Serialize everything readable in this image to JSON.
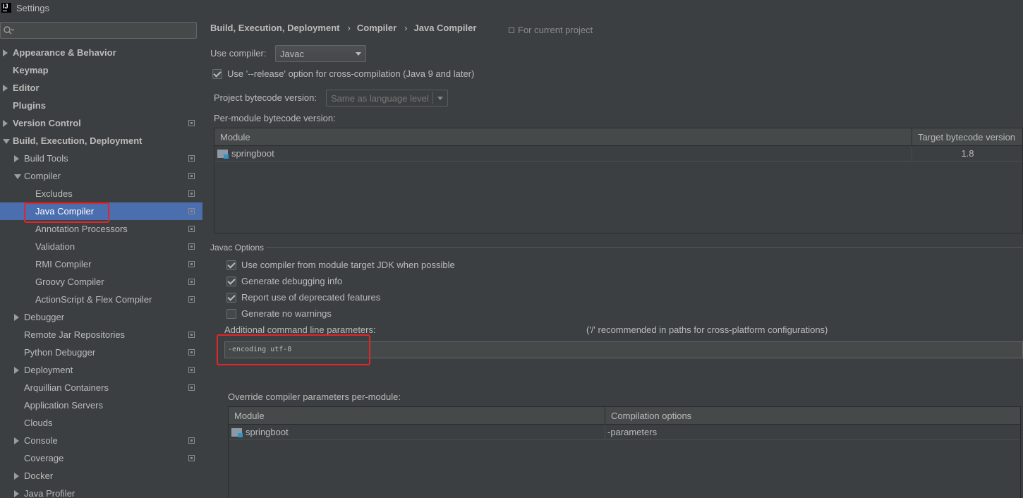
{
  "window": {
    "title": "Settings",
    "icon": "intellij-app-icon"
  },
  "sidebar": {
    "search": {
      "value": "",
      "placeholder": ""
    },
    "items": [
      {
        "label": "Appearance & Behavior",
        "bold": true,
        "expander": "right",
        "level": 0,
        "project_icon": false
      },
      {
        "label": "Keymap",
        "bold": true,
        "expander": "none",
        "level": 0,
        "project_icon": false
      },
      {
        "label": "Editor",
        "bold": true,
        "expander": "right",
        "level": 0,
        "project_icon": false
      },
      {
        "label": "Plugins",
        "bold": true,
        "expander": "none",
        "level": 0,
        "project_icon": false
      },
      {
        "label": "Version Control",
        "bold": true,
        "expander": "right",
        "level": 0,
        "project_icon": true
      },
      {
        "label": "Build, Execution, Deployment",
        "bold": true,
        "expander": "down",
        "level": 0,
        "project_icon": false
      },
      {
        "label": "Build Tools",
        "bold": false,
        "expander": "right",
        "level": 1,
        "project_icon": true
      },
      {
        "label": "Compiler",
        "bold": false,
        "expander": "down",
        "level": 1,
        "project_icon": true
      },
      {
        "label": "Excludes",
        "bold": false,
        "expander": "none",
        "level": 2,
        "project_icon": true
      },
      {
        "label": "Java Compiler",
        "bold": false,
        "expander": "none",
        "level": 2,
        "project_icon": true,
        "selected": true
      },
      {
        "label": "Annotation Processors",
        "bold": false,
        "expander": "none",
        "level": 2,
        "project_icon": true
      },
      {
        "label": "Validation",
        "bold": false,
        "expander": "none",
        "level": 2,
        "project_icon": true
      },
      {
        "label": "RMI Compiler",
        "bold": false,
        "expander": "none",
        "level": 2,
        "project_icon": true
      },
      {
        "label": "Groovy Compiler",
        "bold": false,
        "expander": "none",
        "level": 2,
        "project_icon": true
      },
      {
        "label": "ActionScript & Flex Compiler",
        "bold": false,
        "expander": "none",
        "level": 2,
        "project_icon": true
      },
      {
        "label": "Debugger",
        "bold": false,
        "expander": "right",
        "level": 1,
        "project_icon": false
      },
      {
        "label": "Remote Jar Repositories",
        "bold": false,
        "expander": "none",
        "level": 1,
        "project_icon": true
      },
      {
        "label": "Python Debugger",
        "bold": false,
        "expander": "none",
        "level": 1,
        "project_icon": true
      },
      {
        "label": "Deployment",
        "bold": false,
        "expander": "right",
        "level": 1,
        "project_icon": true
      },
      {
        "label": "Arquillian Containers",
        "bold": false,
        "expander": "none",
        "level": 1,
        "project_icon": true
      },
      {
        "label": "Application Servers",
        "bold": false,
        "expander": "none",
        "level": 1,
        "project_icon": false
      },
      {
        "label": "Clouds",
        "bold": false,
        "expander": "none",
        "level": 1,
        "project_icon": false
      },
      {
        "label": "Console",
        "bold": false,
        "expander": "right",
        "level": 1,
        "project_icon": true
      },
      {
        "label": "Coverage",
        "bold": false,
        "expander": "none",
        "level": 1,
        "project_icon": true
      },
      {
        "label": "Docker",
        "bold": false,
        "expander": "right",
        "level": 1,
        "project_icon": false
      },
      {
        "label": "Java Profiler",
        "bold": false,
        "expander": "right",
        "level": 1,
        "project_icon": false
      }
    ]
  },
  "main": {
    "breadcrumb": [
      "Build, Execution, Deployment",
      "Compiler",
      "Java Compiler"
    ],
    "breadcrumb_sep": "›",
    "for_current_project": "For current project",
    "use_compiler_label": "Use compiler:",
    "use_compiler_value": "Javac",
    "release_option": {
      "label": "Use '--release' option for cross-compilation (Java 9 and later)",
      "checked": true
    },
    "bytecode_label": "Project bytecode version:",
    "bytecode_value": "Same as language level",
    "per_module_label": "Per-module bytecode version:",
    "bytecode_table": {
      "columns": [
        "Module",
        "Target bytecode version"
      ],
      "rows": [
        {
          "module": "springboot",
          "version": "1.8"
        }
      ]
    },
    "javac_options": {
      "title": "Javac Options",
      "checkboxes": [
        {
          "label": "Use compiler from module target JDK when possible",
          "checked": true
        },
        {
          "label": "Generate debugging info",
          "checked": true
        },
        {
          "label": "Report use of deprecated features",
          "checked": true
        },
        {
          "label": "Generate no warnings",
          "checked": false
        }
      ],
      "additional_params_label": "Additional command line parameters:",
      "additional_params_hint": "('/' recommended in paths for cross-platform configurations)",
      "additional_params_value": "-encoding utf-8",
      "override_label": "Override compiler parameters per-module:",
      "override_table": {
        "columns": [
          "Module",
          "Compilation options"
        ],
        "rows": [
          {
            "module": "springboot",
            "options": "-parameters"
          }
        ]
      }
    }
  },
  "colors": {
    "background": "#3c3f41",
    "text": "#bbbbbb",
    "selection": "#4b6eaf",
    "highlight_annotation": "#e0262b"
  }
}
